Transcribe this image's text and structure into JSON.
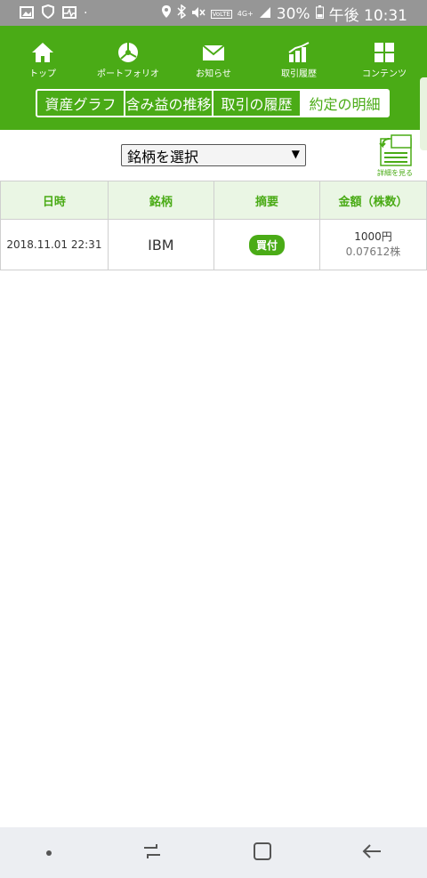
{
  "status_bar": {
    "battery": "30%",
    "time_label": "午後 10:31",
    "network": "4G+",
    "volte": "VoLTE"
  },
  "nav": [
    {
      "label": "トップ",
      "icon": "home-icon"
    },
    {
      "label": "ポートフォリオ",
      "icon": "pie-chart-icon"
    },
    {
      "label": "お知らせ",
      "icon": "mail-icon"
    },
    {
      "label": "取引履歴",
      "icon": "bar-chart-icon"
    },
    {
      "label": "コンテンツ",
      "icon": "grid-icon"
    }
  ],
  "tabs": [
    {
      "label": "資産グラフ"
    },
    {
      "label": "含み益の推移"
    },
    {
      "label": "取引の履歴"
    },
    {
      "label": "約定の明細"
    }
  ],
  "active_tab": "約定の明細",
  "selector": {
    "value": "銘柄を選択",
    "detail_label": "詳細を見る"
  },
  "table": {
    "headers": [
      "日時",
      "銘柄",
      "摘要",
      "金額（株数）"
    ],
    "rows": [
      {
        "date": "2018.11.01 22:31",
        "name": "IBM",
        "type": "買付",
        "amount": "1000円",
        "shares": "0.07612株"
      }
    ]
  },
  "colors": {
    "brand": "#4aab16",
    "header_bg": "#eaf6e4"
  }
}
